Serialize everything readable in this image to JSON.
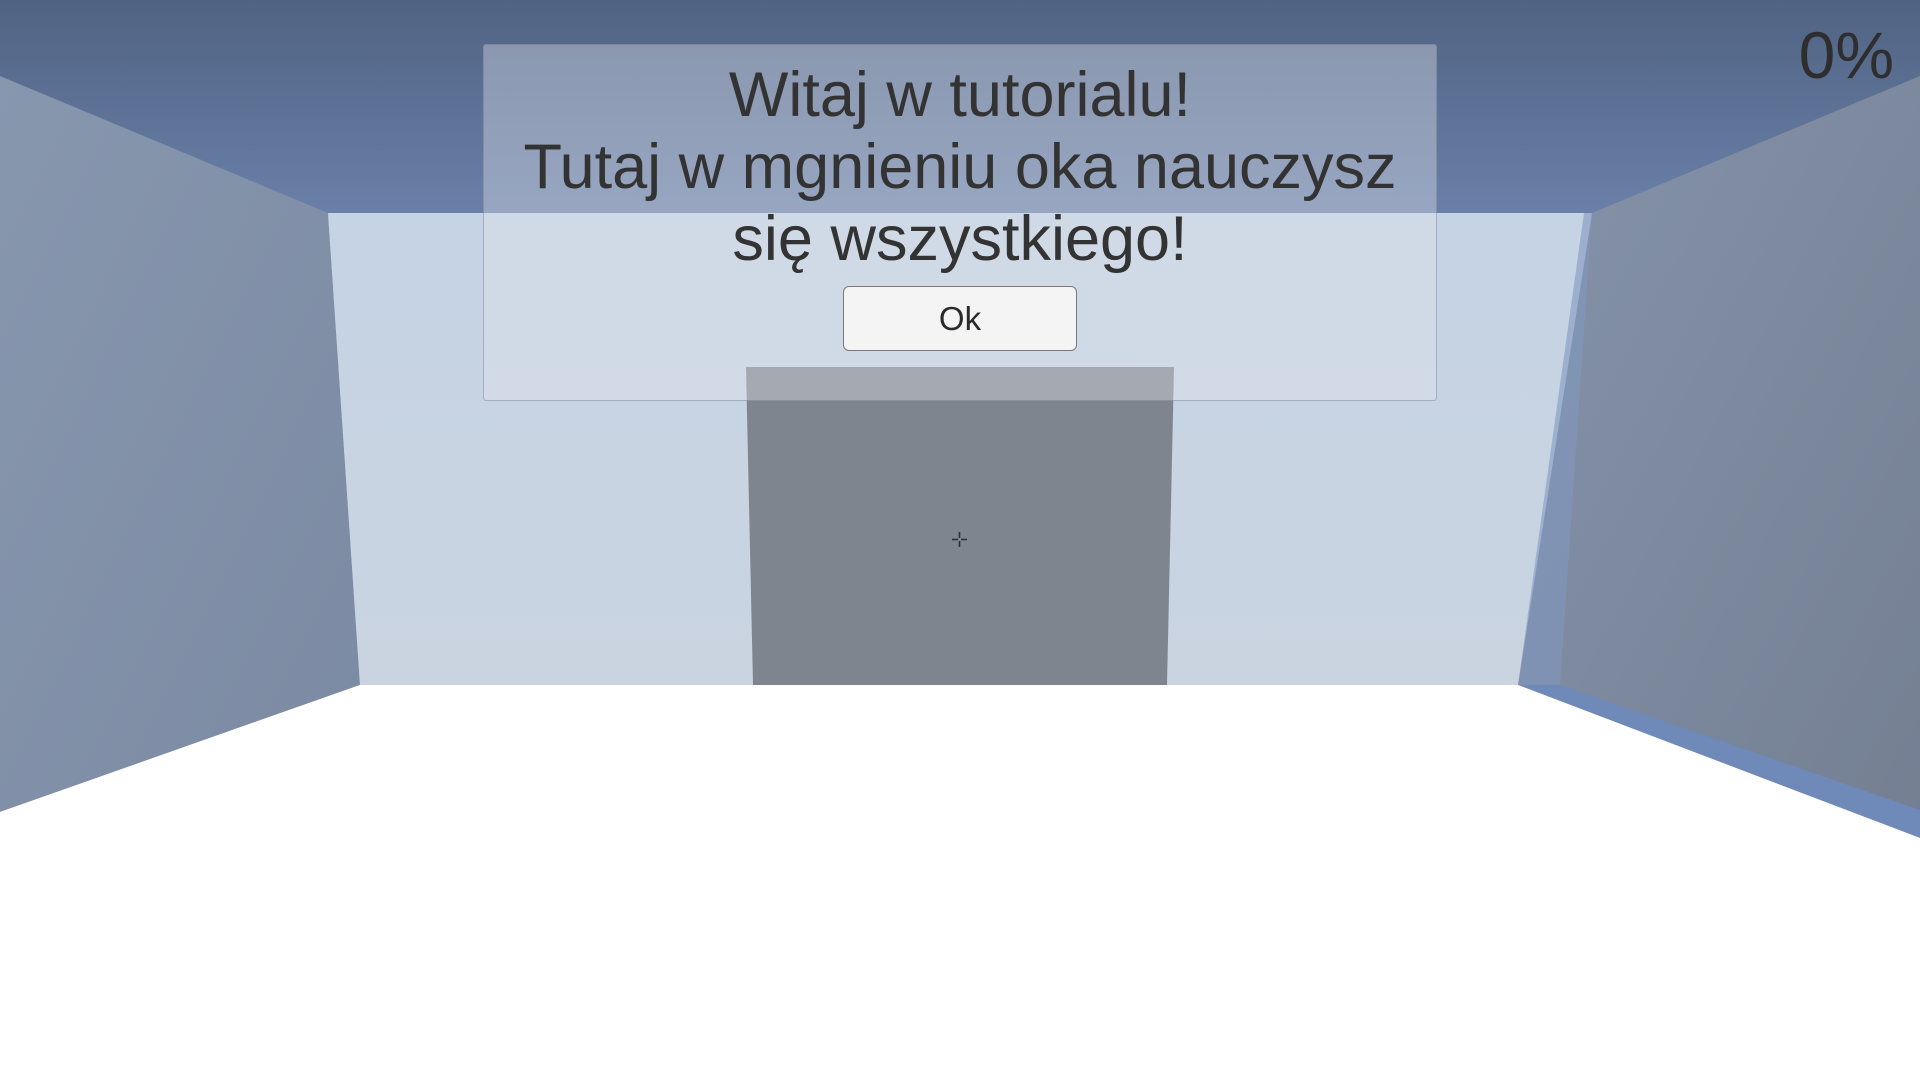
{
  "hud": {
    "progress_percent": "0%"
  },
  "dialog": {
    "message_lines": [
      "Witaj w tutorialu!",
      "Tutaj w mgnieniu oka nauczysz",
      "się wszystkiego!"
    ],
    "ok_label": "Ok"
  },
  "colors": {
    "ceiling": "#56698d",
    "back_wall": "#c9d5e3",
    "side_wall": "#7f8ea5",
    "door": "#7e858e",
    "floor": "#ffffff"
  },
  "icons": {
    "crosshair": "crosshair-icon"
  }
}
